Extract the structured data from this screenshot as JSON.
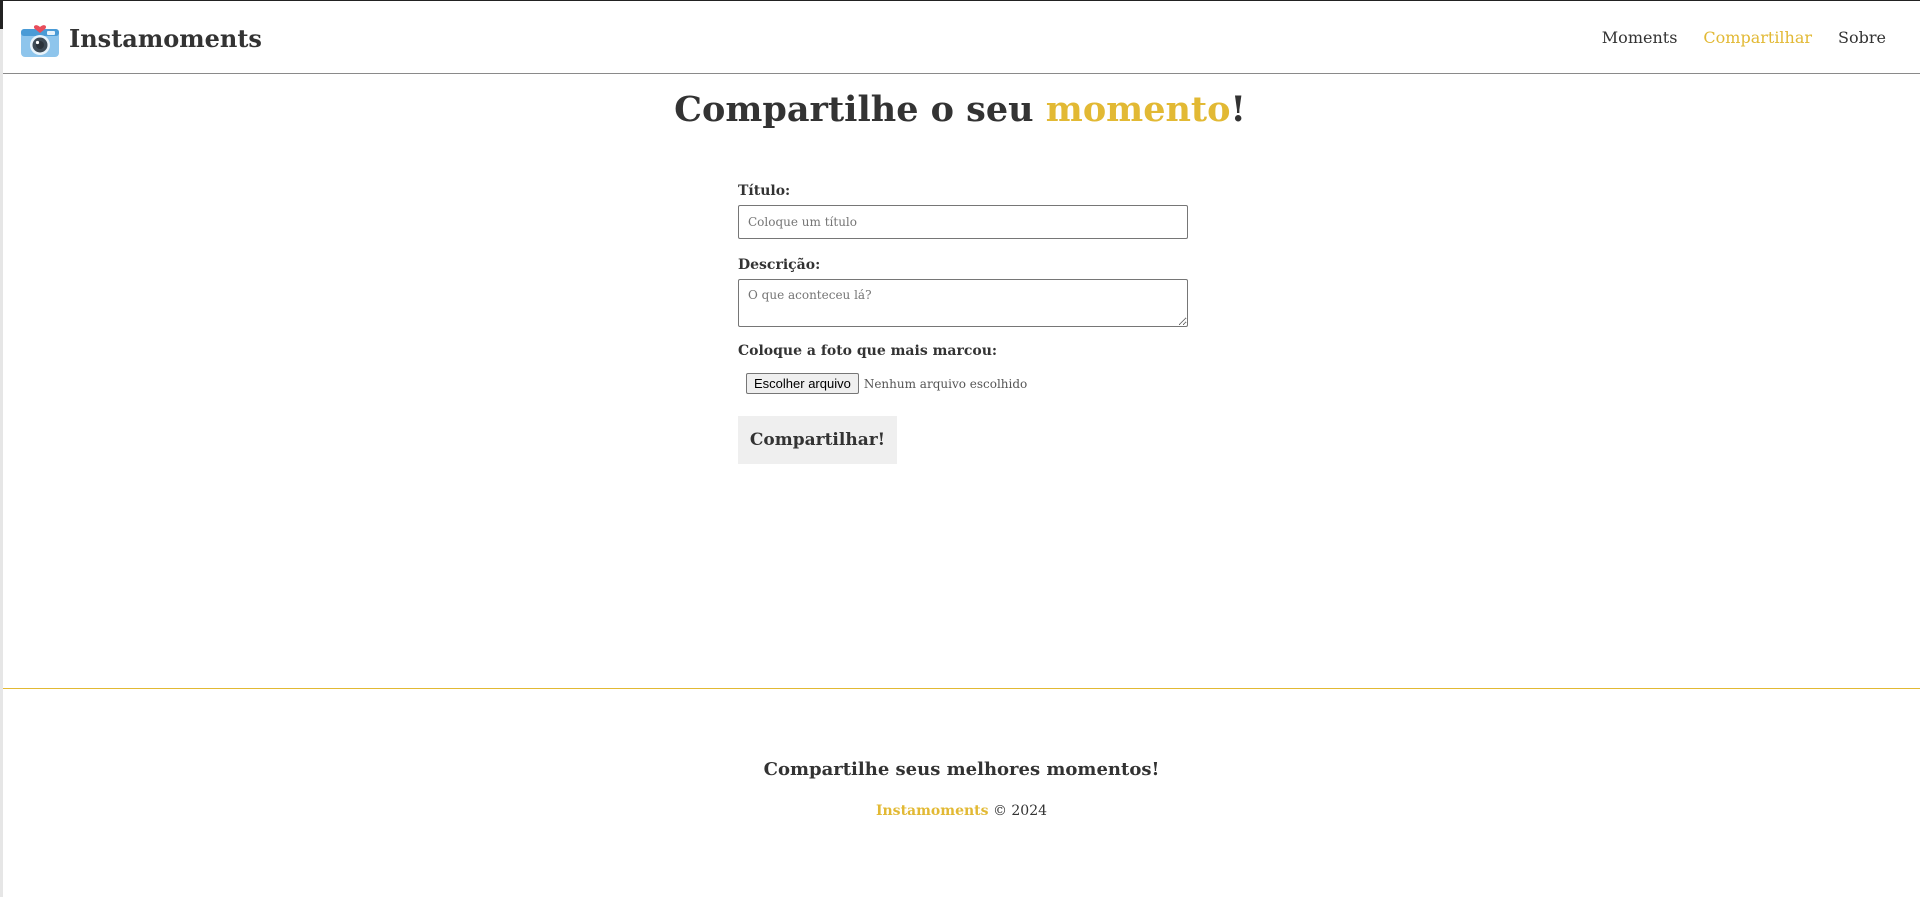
{
  "header": {
    "brand_name": "Instamoments",
    "logo_icon": "camera-heart-icon",
    "nav": {
      "moments": "Moments",
      "share": "Compartilhar",
      "about": "Sobre"
    },
    "active_nav": "share"
  },
  "main": {
    "title_prefix": "Compartilhe o seu ",
    "title_highlight": "momento",
    "title_suffix": "!",
    "form": {
      "title_label": "Título:",
      "title_placeholder": "Coloque um título",
      "title_value": "",
      "description_label": "Descrição:",
      "description_placeholder": "O que aconteceu lá?",
      "description_value": "",
      "photo_label": "Coloque a foto que mais marcou:",
      "file_button_label": "Escolher arquivo",
      "file_status": "Nenhum arquivo escolhido",
      "submit_label": "Compartilhar!"
    }
  },
  "footer": {
    "tagline": "Compartilhe seus melhores momentos!",
    "brand": "Instamoments",
    "copyright": " © 2024"
  },
  "colors": {
    "accent": "#e2b934",
    "text": "#333333",
    "button_bg": "#efefef"
  }
}
